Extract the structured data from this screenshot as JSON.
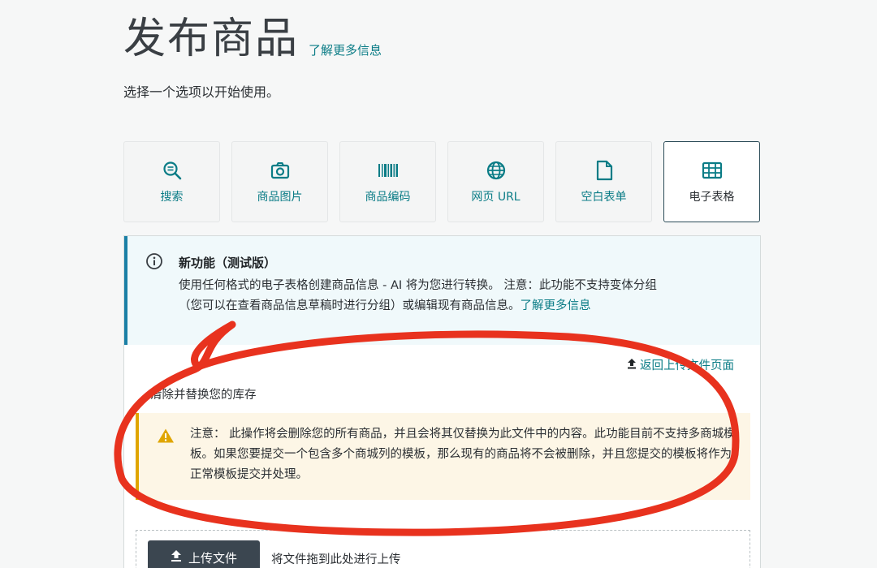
{
  "header": {
    "title": "发布商品",
    "learn_more": "了解更多信息",
    "subtitle": "选择一个选项以开始使用。"
  },
  "options": [
    {
      "label": "搜索",
      "icon": "search-icon"
    },
    {
      "label": "商品图片",
      "icon": "camera-icon"
    },
    {
      "label": "商品编码",
      "icon": "barcode-icon"
    },
    {
      "label": "网页 URL",
      "icon": "globe-icon"
    },
    {
      "label": "空白表单",
      "icon": "document-icon"
    },
    {
      "label": "电子表格",
      "icon": "spreadsheet-icon",
      "selected": true
    }
  ],
  "info": {
    "title": "新功能（测试版）",
    "text_line1": "使用任何格式的电子表格创建商品信息 - AI 将为您进行转换。 注意：此功能不支持变体分组",
    "text_line2": "（您可以在查看商品信息草稿时进行分组）或编辑现有商品信息。",
    "link": "了解更多信息"
  },
  "back_link": "返回上传文件页面",
  "section_label": "清除并替换您的库存",
  "warning": {
    "text": "注意： 此操作将会删除您的所有商品，并且会将其仅替换为此文件中的内容。此功能目前不支持多商城模板。如果您要提交一个包含多个商城列的模板，那么现有的商品将不会被删除，并且您提交的模板将作为正常模板提交并处理。"
  },
  "upload": {
    "button_label": "上传文件",
    "drop_hint": "将文件拖到此处进行上传"
  },
  "colors": {
    "accent": "#0a7c86",
    "info_border": "#1a7fa5",
    "warning_border": "#e0a500",
    "annotation": "#e8321e"
  }
}
